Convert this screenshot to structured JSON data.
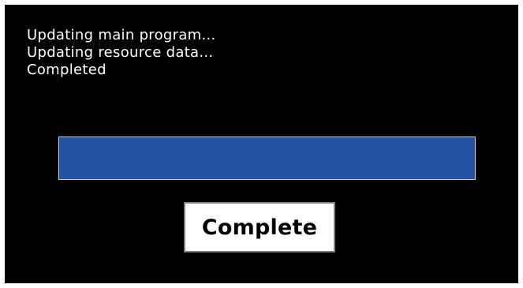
{
  "log": {
    "lines": [
      "Updating main program...",
      "Updating resource data...",
      "Completed"
    ]
  },
  "progress": {
    "percent": 100,
    "fill_color": "#2552a3",
    "border_color": "#c8c8c8"
  },
  "status": {
    "label": "Complete"
  },
  "colors": {
    "background": "#000000",
    "text": "#ffffff"
  }
}
